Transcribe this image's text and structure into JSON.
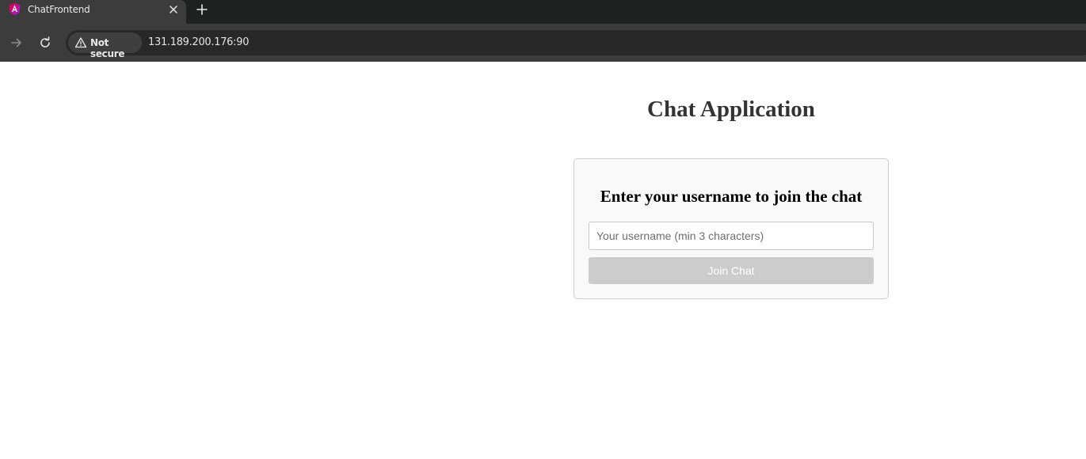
{
  "browser": {
    "tab": {
      "title": "ChatFrontend",
      "favicon": "angular-logo-icon"
    },
    "new_tab_icon": "plus-icon",
    "close_icon": "close-icon",
    "nav": {
      "forward_icon": "arrow-right-icon",
      "reload_icon": "reload-icon"
    },
    "security": {
      "icon": "warning-triangle-icon",
      "label": "Not secure"
    },
    "url": "131.189.200.176:90"
  },
  "app": {
    "title": "Chat Application",
    "join_card": {
      "heading": "Enter your username to join the chat",
      "username_placeholder": "Your username (min 3 characters)",
      "username_value": "",
      "join_button_label": "Join Chat",
      "join_button_disabled": true
    }
  },
  "colors": {
    "tabstrip_bg": "#1f2020",
    "toolbar_bg": "#3c3c3c",
    "omnibox_bg": "#282828",
    "title_text": "#333333",
    "card_bg": "#f9f9f9",
    "disabled_button_bg": "#cccccc"
  }
}
